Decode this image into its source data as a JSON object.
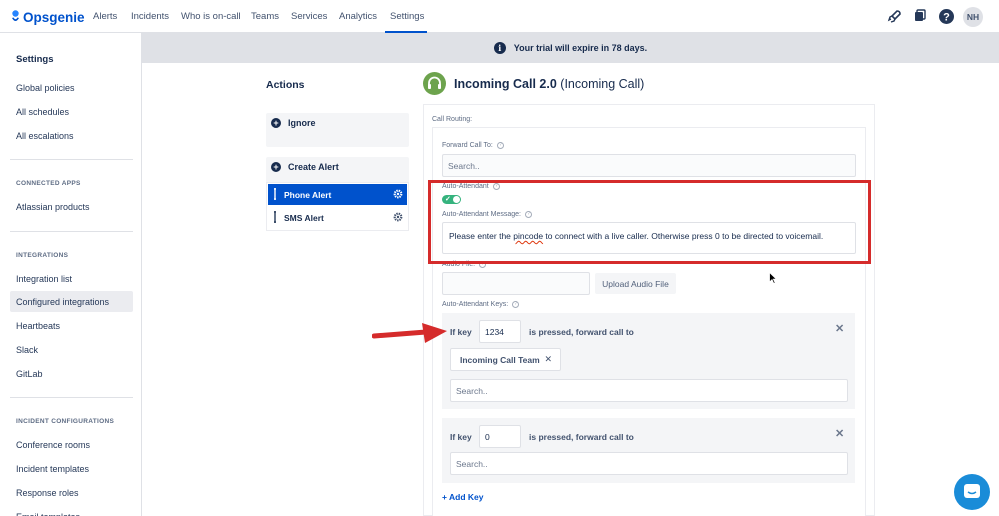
{
  "brand": {
    "name": "Opsgenie"
  },
  "nav": {
    "items": [
      "Alerts",
      "Incidents",
      "Who is on-call",
      "Teams",
      "Services",
      "Analytics",
      "Settings"
    ],
    "active": "Settings"
  },
  "header": {
    "avatar_initials": "NH"
  },
  "sidebar": {
    "title": "Settings",
    "top_items": [
      "Global policies",
      "All schedules",
      "All escalations"
    ],
    "connected_heading": "CONNECTED APPS",
    "connected_items": [
      "Atlassian products"
    ],
    "integrations_heading": "INTEGRATIONS",
    "integrations_items": [
      "Integration list",
      "Configured integrations",
      "Heartbeats",
      "Slack",
      "GitLab"
    ],
    "incident_heading": "INCIDENT CONFIGURATIONS",
    "incident_items": [
      "Conference rooms",
      "Incident templates",
      "Response roles",
      "Email templates"
    ]
  },
  "banner": {
    "text": "Your trial will expire in 78 days."
  },
  "actions": {
    "title": "Actions",
    "ignore_label": "Ignore",
    "create_alert_label": "Create Alert",
    "alerts": [
      "Phone Alert",
      "SMS Alert"
    ],
    "selected": "Phone Alert"
  },
  "integration": {
    "name": "Incoming Call 2.0",
    "type": "(Incoming Call)"
  },
  "form": {
    "call_routing_label": "Call Routing:",
    "forward_label": "Forward Call To:",
    "forward_placeholder": "Search..",
    "auto_attendant_label": "Auto-Attendant",
    "auto_attendant_enabled": true,
    "message_label": "Auto-Attendant Message:",
    "message_before": "Please enter the ",
    "message_misspelled": "pincode",
    "message_after": " to connect with a live caller. Otherwise press 0 to be directed to voicemail.",
    "audio_label": "Audio File:",
    "upload_label": "Upload Audio File",
    "keys_label": "Auto-Attendant Keys:",
    "if_key_label": "If key",
    "pressed_label": "is pressed, forward call to",
    "key1_value": "1234",
    "key1_team": "Incoming Call Team",
    "key2_value": "0",
    "search_placeholder": "Search..",
    "add_key_label": "+ Add Key"
  },
  "colors": {
    "brand_blue": "#0052cc",
    "highlight_red": "#d52b2b",
    "toggle_green": "#36b37e"
  }
}
